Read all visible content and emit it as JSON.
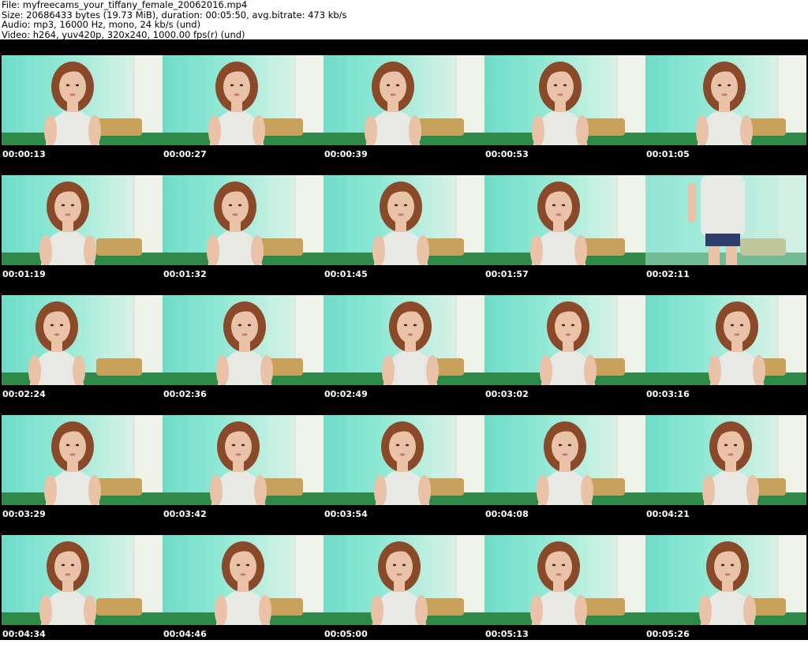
{
  "header": {
    "file_line": "File: myfreecams_your_tiffany_female_20062016.mp4",
    "size_line": "Size: 20686433 bytes (19.73 MiB), duration: 00:05:50, avg.bitrate: 473 kb/s",
    "audio_line": "Audio: mp3, 16000 Hz, mono, 24 kb/s (und)",
    "video_line": "Video: h264, yuv420p, 320x240, 1000.00 fps(r) (und)"
  },
  "thumbnails": [
    {
      "timestamp": "00:00:13"
    },
    {
      "timestamp": "00:00:27"
    },
    {
      "timestamp": "00:00:39"
    },
    {
      "timestamp": "00:00:53"
    },
    {
      "timestamp": "00:01:05"
    },
    {
      "timestamp": "00:01:19"
    },
    {
      "timestamp": "00:01:32"
    },
    {
      "timestamp": "00:01:45"
    },
    {
      "timestamp": "00:01:57"
    },
    {
      "timestamp": "00:02:11"
    },
    {
      "timestamp": "00:02:24"
    },
    {
      "timestamp": "00:02:36"
    },
    {
      "timestamp": "00:02:49"
    },
    {
      "timestamp": "00:03:02"
    },
    {
      "timestamp": "00:03:16"
    },
    {
      "timestamp": "00:03:29"
    },
    {
      "timestamp": "00:03:42"
    },
    {
      "timestamp": "00:03:54"
    },
    {
      "timestamp": "00:04:08"
    },
    {
      "timestamp": "00:04:21"
    },
    {
      "timestamp": "00:04:34"
    },
    {
      "timestamp": "00:04:46"
    },
    {
      "timestamp": "00:05:00"
    },
    {
      "timestamp": "00:05:13"
    },
    {
      "timestamp": "00:05:26"
    }
  ],
  "colors": {
    "sheet_background": "#000000",
    "timestamp_text": "#ffffff",
    "wall_teal": "#8ee8d4",
    "wall_light": "#eef2e8",
    "floor_green": "#2f8a4a",
    "hair_auburn": "#8a4a2a",
    "skin": "#e9c2a8",
    "top_white": "#e8e8e4"
  }
}
